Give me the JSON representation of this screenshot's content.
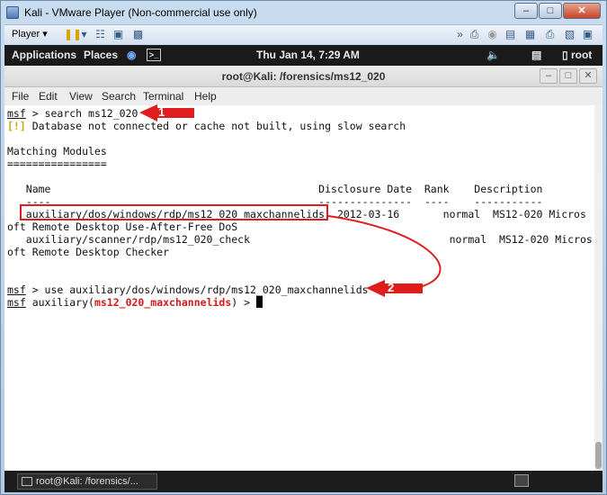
{
  "vmware": {
    "title": "Kali - VMware Player (Non-commercial use only)",
    "player_menu": "Player",
    "window_buttons": [
      "minimize",
      "maximize",
      "close"
    ]
  },
  "gnome_bar": {
    "applications": "Applications",
    "places": "Places",
    "clock": "Thu Jan 14,  7:29 AM",
    "user": "root"
  },
  "terminal": {
    "title": "root@Kali: /forensics/ms12_020",
    "menu": [
      "File",
      "Edit",
      "View",
      "Search",
      "Terminal",
      "Help"
    ],
    "lines": {
      "prompt": "msf",
      "cmd1": " > search ms12_020",
      "warn_tag": "[!]",
      "warn_text": " Database not connected or cache not built, using slow search",
      "matching": "Matching Modules",
      "underline": "================",
      "header": "   Name                                           Disclosure Date  Rank    Description",
      "header_rule": "   ----                                           ---------------  ----    -----------",
      "row1": "   auxiliary/dos/windows/rdp/ms12_020_maxchannelids  2012-03-16       normal  MS12-020 Micros",
      "row1_wrap": "oft Remote Desktop Use-After-Free DoS",
      "row2": "   auxiliary/scanner/rdp/ms12_020_check                                normal  MS12-020 Micros",
      "row2_wrap": "oft Remote Desktop Checker",
      "cmd2": " > use auxiliary/dos/windows/rdp/ms12_020_maxchannelids",
      "prompt2_pre": " auxiliary(",
      "prompt2_module": "ms12_020_maxchannelids",
      "prompt2_post": ") > "
    }
  },
  "taskbar": {
    "item": "root@Kali: /forensics/..."
  },
  "annotations": {
    "badge1": "1",
    "badge2": "2",
    "color": "#e01d1d"
  }
}
